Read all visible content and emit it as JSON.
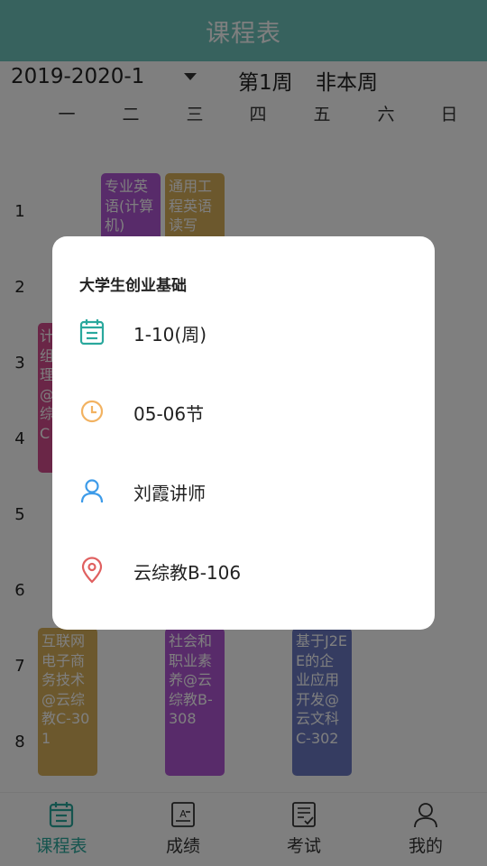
{
  "header": {
    "title": "课程表"
  },
  "term": {
    "value": "2019-2020-1",
    "week": "第1周",
    "week_status": "非本周"
  },
  "days": [
    "一",
    "二",
    "三",
    "四",
    "五",
    "六",
    "日"
  ],
  "periods": [
    "1",
    "2",
    "3",
    "4",
    "5",
    "6",
    "7",
    "8"
  ],
  "courses": {
    "english": "专业英语(计算机)",
    "eng_reading": "通用工程英语读写",
    "pink_partial": "计组理@综C",
    "ecommerce": "互联网电子商务技术@云综教C-301",
    "society": "社会和职业素养@云综教B-308",
    "j2ee": "基于J2EE的企业应用开发@云文科C-302"
  },
  "dialog": {
    "title": "大学生创业基础",
    "weeks": "1-10(周)",
    "sections": "05-06节",
    "teacher": "刘霞讲师",
    "location": "云综教B-106"
  },
  "tabs": {
    "schedule": "课程表",
    "grades": "成绩",
    "exams": "考试",
    "mine": "我的"
  },
  "colors": {
    "header": "#6ec4bd",
    "accent": "#2aa89d",
    "course_purple": "#b157d4",
    "course_gold": "#d8b05a",
    "course_pink": "#d44d8f",
    "course_blue": "#6a78c2"
  }
}
